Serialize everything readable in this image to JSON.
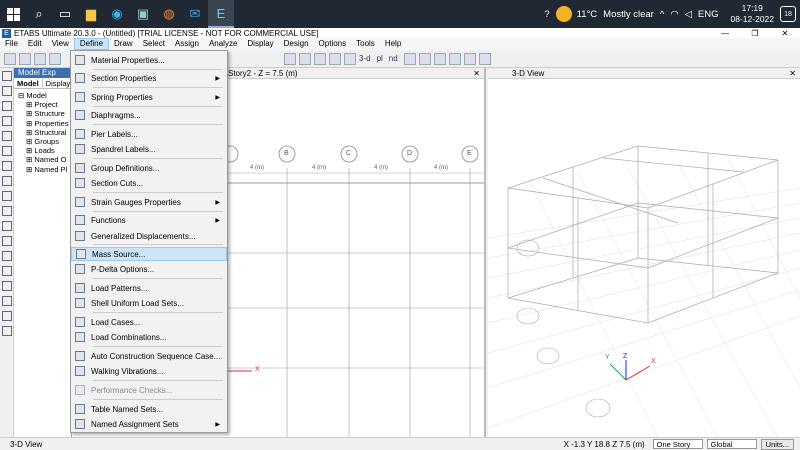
{
  "taskbar": {
    "icons": [
      "windows-start-icon",
      "search-icon",
      "task-view-icon",
      "explorer-icon",
      "edge-icon",
      "store-icon",
      "chrome-icon",
      "mail-icon",
      "etabs-icon"
    ],
    "weather_temp": "11°C",
    "weather_text": "Mostly clear",
    "language": "ENG",
    "time": "17:19",
    "date": "08-12-2022",
    "notifications": "18"
  },
  "titlebar": {
    "title": "ETABS Ultimate 20.3.0 - (Untitled)  [TRIAL LICENSE - NOT FOR COMMERCIAL USE]"
  },
  "menubar": [
    "File",
    "Edit",
    "View",
    "Define",
    "Draw",
    "Select",
    "Assign",
    "Analyze",
    "Display",
    "Design",
    "Options",
    "Tools",
    "Help"
  ],
  "toolbar": {
    "threed": "3-d",
    "plan": "pl",
    "elev": "nd"
  },
  "explorer": {
    "title": "Model Exp",
    "tabs": [
      "Model",
      "Display"
    ],
    "root": "Model",
    "children": [
      "Project",
      "Structure",
      "Properties",
      "Structural",
      "Groups",
      "Loads",
      "Named O",
      "Named Pl"
    ]
  },
  "plan_view": {
    "title": "Story2 - Z = 7.5 (m)",
    "grid_labels": [
      "B",
      "C",
      "D",
      "E"
    ],
    "dims": [
      "4 (m)",
      "4 (m)",
      "4 (m)",
      "4 (m)"
    ],
    "x_axis": "X"
  },
  "view3d": {
    "title": "3-D View",
    "axes": [
      "Y",
      "Z",
      "X"
    ]
  },
  "define_menu": {
    "items": [
      {
        "label": "Material Properties...",
        "icon": "material-icon",
        "arrow": false
      },
      {
        "label": "Section Properties",
        "icon": "section-icon",
        "arrow": true
      },
      {
        "label": "Spring Properties",
        "icon": "spring-icon",
        "arrow": true
      },
      {
        "label": "Diaphragms...",
        "icon": "diaphragm-icon",
        "arrow": false
      },
      {
        "label": "Pier Labels...",
        "icon": "pier-icon",
        "arrow": false
      },
      {
        "label": "Spandrel Labels...",
        "icon": "spandrel-icon",
        "arrow": false
      },
      {
        "label": "Group Definitions...",
        "icon": "group-icon",
        "arrow": false
      },
      {
        "label": "Section Cuts...",
        "icon": "section-cut-icon",
        "arrow": false
      },
      {
        "label": "Strain Gauges Properties",
        "icon": "strain-gauge-icon",
        "arrow": true
      },
      {
        "label": "Functions",
        "icon": "functions-icon",
        "arrow": true
      },
      {
        "label": "Generalized Displacements...",
        "icon": "displacement-icon",
        "arrow": false
      },
      {
        "label": "Mass Source...",
        "icon": "mass-source-icon",
        "arrow": false,
        "highlighted": true
      },
      {
        "label": "P-Delta Options...",
        "icon": "pdelta-icon",
        "arrow": false
      },
      {
        "label": "Load Patterns...",
        "icon": "load-pattern-icon",
        "arrow": false
      },
      {
        "label": "Shell Uniform Load Sets...",
        "icon": "shell-load-icon",
        "arrow": false
      },
      {
        "label": "Load Cases...",
        "icon": "load-case-icon",
        "arrow": false
      },
      {
        "label": "Load Combinations...",
        "icon": "load-combo-icon",
        "arrow": false
      },
      {
        "label": "Auto Construction Sequence Case...",
        "icon": "construction-icon",
        "arrow": false
      },
      {
        "label": "Walking Vibrations...",
        "icon": "walking-icon",
        "arrow": false
      },
      {
        "label": "Performance Checks...",
        "icon": "performance-icon",
        "arrow": false,
        "disabled": true
      },
      {
        "label": "Table Named Sets...",
        "icon": "table-set-icon",
        "arrow": false
      },
      {
        "label": "Named Assignment Sets",
        "icon": "assignment-set-icon",
        "arrow": true
      }
    ]
  },
  "statusbar": {
    "left": "3-D View",
    "coords": "X -1.3  Y 18.8  Z 7.5 (m)",
    "story_select": "One Story",
    "coord_select": "Global",
    "units_button": "Units..."
  }
}
